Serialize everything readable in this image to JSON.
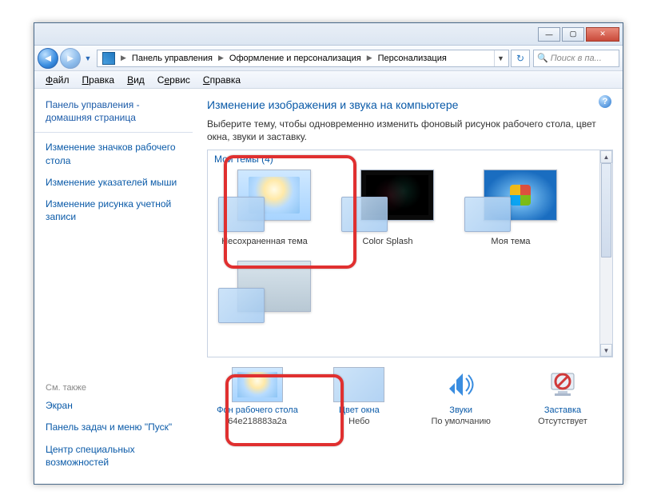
{
  "titlebar": {
    "min": "—",
    "max": "▢",
    "close": "✕"
  },
  "nav": {
    "crumbs": [
      "Панель управления",
      "Оформление и персонализация",
      "Персонализация"
    ],
    "search_placeholder": "Поиск в па..."
  },
  "menubar": [
    "Файл",
    "Правка",
    "Вид",
    "Сервис",
    "Справка"
  ],
  "sidebar": {
    "home": "Панель управления - домашняя страница",
    "links": [
      "Изменение значков рабочего стола",
      "Изменение указателей мыши",
      "Изменение рисунка учетной записи"
    ],
    "see_also_label": "См. также",
    "see_also": [
      "Экран",
      "Панель задач и меню \"Пуск\"",
      "Центр специальных возможностей"
    ]
  },
  "content": {
    "title": "Изменение изображения и звука на компьютере",
    "desc": "Выберите тему, чтобы одновременно изменить фоновый рисунок рабочего стола, цвет окна, звуки и заставку.",
    "themes_header": "Мои темы (4)",
    "themes": [
      {
        "label": "Несохраненная тема"
      },
      {
        "label": "Color Splash"
      },
      {
        "label": "Моя тема"
      }
    ],
    "settings": [
      {
        "link": "Фон рабочего стола",
        "value": "64e218883a2a"
      },
      {
        "link": "Цвет окна",
        "value": "Небо"
      },
      {
        "link": "Звуки",
        "value": "По умолчанию"
      },
      {
        "link": "Заставка",
        "value": "Отсутствует"
      }
    ]
  }
}
